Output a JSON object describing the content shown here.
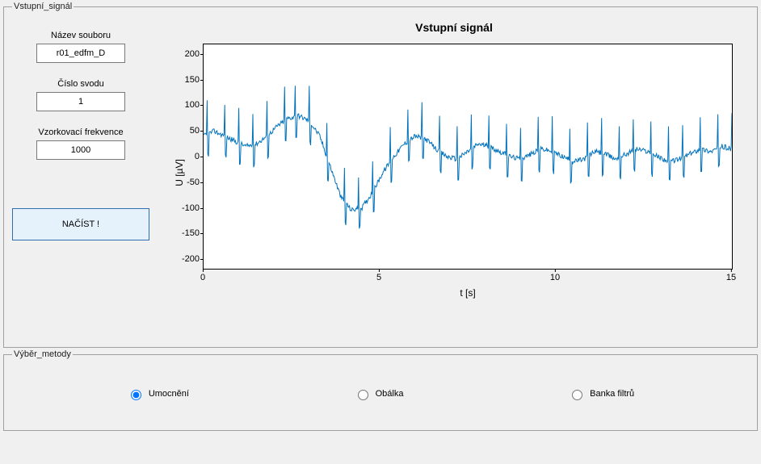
{
  "panels": {
    "signal_legend": "Vstupní_signál",
    "method_legend": "Výběr_metody"
  },
  "controls": {
    "filename_label": "Název souboru",
    "filename_value": "r01_edfm_D",
    "lead_label": "Číslo svodu",
    "lead_value": "1",
    "fs_label": "Vzorkovací frekvence",
    "fs_value": "1000",
    "load_button": "NAČÍST !"
  },
  "methods": {
    "opt1": "Umocnění",
    "opt2": "Obálka",
    "opt3": "Banka filtrů",
    "selected": "opt1"
  },
  "chart_data": {
    "type": "line",
    "title": "Vstupní signál",
    "xlabel": "t [s]",
    "ylabel": "U [µV]",
    "xlim": [
      0,
      15
    ],
    "ylim": [
      -220,
      220
    ],
    "yticks": [
      -200,
      -150,
      -100,
      -50,
      0,
      50,
      100,
      150,
      200
    ],
    "xticks": [
      0,
      5,
      10,
      15
    ],
    "baseline": [
      [
        0.0,
        40
      ],
      [
        0.3,
        50
      ],
      [
        0.6,
        40
      ],
      [
        0.9,
        30
      ],
      [
        1.2,
        20
      ],
      [
        1.5,
        25
      ],
      [
        1.8,
        40
      ],
      [
        2.1,
        60
      ],
      [
        2.4,
        75
      ],
      [
        2.7,
        80
      ],
      [
        3.0,
        70
      ],
      [
        3.3,
        40
      ],
      [
        3.6,
        -20
      ],
      [
        3.9,
        -80
      ],
      [
        4.2,
        -105
      ],
      [
        4.5,
        -100
      ],
      [
        4.8,
        -70
      ],
      [
        5.1,
        -30
      ],
      [
        5.4,
        0
      ],
      [
        5.7,
        25
      ],
      [
        6.0,
        40
      ],
      [
        6.3,
        35
      ],
      [
        6.6,
        15
      ],
      [
        6.9,
        0
      ],
      [
        7.2,
        -5
      ],
      [
        7.5,
        10
      ],
      [
        7.8,
        25
      ],
      [
        8.1,
        20
      ],
      [
        8.4,
        10
      ],
      [
        8.7,
        0
      ],
      [
        9.0,
        -5
      ],
      [
        9.3,
        5
      ],
      [
        9.6,
        15
      ],
      [
        9.9,
        10
      ],
      [
        10.2,
        0
      ],
      [
        10.5,
        -10
      ],
      [
        10.8,
        -5
      ],
      [
        11.1,
        10
      ],
      [
        11.4,
        5
      ],
      [
        11.7,
        -5
      ],
      [
        12.0,
        5
      ],
      [
        12.3,
        15
      ],
      [
        12.6,
        10
      ],
      [
        12.9,
        0
      ],
      [
        13.2,
        -10
      ],
      [
        13.5,
        -5
      ],
      [
        13.8,
        5
      ],
      [
        14.1,
        15
      ],
      [
        14.4,
        10
      ],
      [
        14.7,
        20
      ],
      [
        15.0,
        15
      ]
    ],
    "spikes_t": [
      0.1,
      0.6,
      1.0,
      1.4,
      1.8,
      2.3,
      2.6,
      3.0,
      3.5,
      4.0,
      4.4,
      4.8,
      5.3,
      5.8,
      6.2,
      6.7,
      7.2,
      7.6,
      8.1,
      8.6,
      9.0,
      9.5,
      9.9,
      10.4,
      10.9,
      11.3,
      11.8,
      12.2,
      12.7,
      13.2,
      13.6,
      14.1,
      14.6,
      15.0
    ],
    "spike_up": 65,
    "spike_down": 40,
    "noise_amp": 10,
    "color": "#0072bd"
  }
}
